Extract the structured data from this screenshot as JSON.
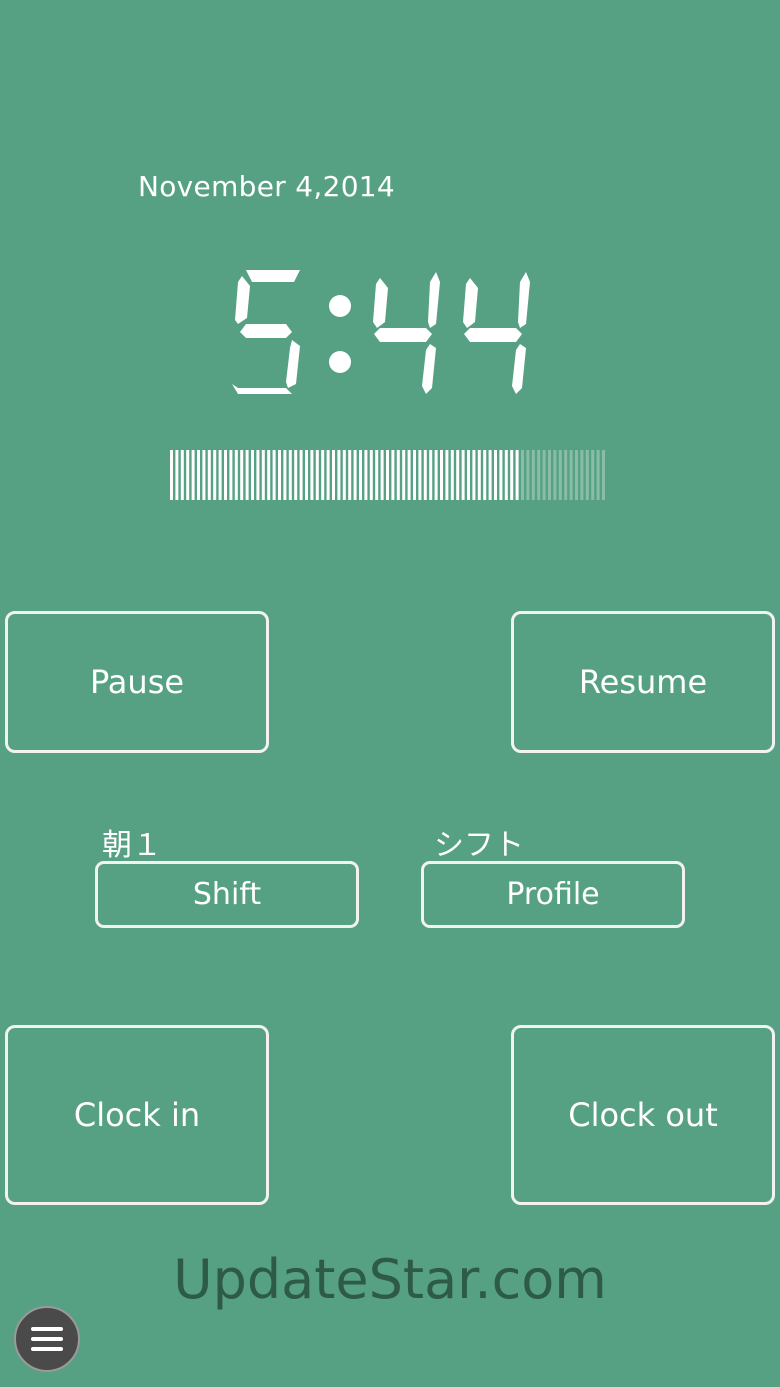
{
  "date": "November 4,2014",
  "time": "5:44",
  "progress": {
    "fraction": 0.8
  },
  "buttons": {
    "pause": "Pause",
    "resume": "Resume",
    "shift": "Shift",
    "profile": "Profile",
    "clock_in": "Clock in",
    "clock_out": "Clock out"
  },
  "shift_value": "朝１",
  "profile_value": "シフト",
  "watermark": "UpdateStar.com",
  "menu_icon": "hamburger-menu-icon",
  "colors": {
    "background": "#56a183",
    "foreground": "#ffffff"
  }
}
